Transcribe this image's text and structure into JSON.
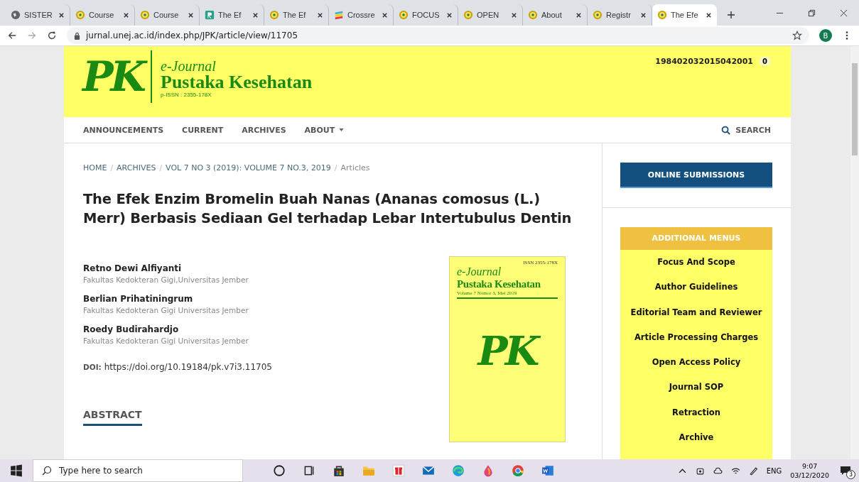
{
  "browser": {
    "tabs": [
      {
        "title": "SISTER",
        "kind": "globe",
        "selected": false
      },
      {
        "title": "Course",
        "kind": "seal",
        "selected": false
      },
      {
        "title": "Course",
        "kind": "seal",
        "selected": false
      },
      {
        "title": "The Ef",
        "kind": "r",
        "selected": false
      },
      {
        "title": "The Ef",
        "kind": "seal",
        "selected": false
      },
      {
        "title": "Crossre",
        "kind": "stripes",
        "selected": false
      },
      {
        "title": "FOCUS",
        "kind": "seal",
        "selected": false
      },
      {
        "title": "OPEN",
        "kind": "seal",
        "selected": false
      },
      {
        "title": "About",
        "kind": "seal",
        "selected": false
      },
      {
        "title": "Registr",
        "kind": "seal",
        "selected": false
      },
      {
        "title": "The Efe",
        "kind": "seal",
        "selected": true
      }
    ],
    "url": "jurnal.unej.ac.id/index.php/JPK/article/view/11705",
    "profile": "B"
  },
  "header": {
    "logo": "PK",
    "ejournal": "e-Journal",
    "name": "Pustaka Kesehatan",
    "issn": "p-ISSN : 2355-178X",
    "user": "198402032015042001",
    "count": "0"
  },
  "nav": {
    "items": [
      "ANNOUNCEMENTS",
      "CURRENT",
      "ARCHIVES",
      "ABOUT"
    ],
    "search": "SEARCH"
  },
  "breadcrumb": {
    "separator": "/",
    "items": [
      "HOME",
      "ARCHIVES",
      "VOL 7 NO 3 (2019): VOLUME 7 NO.3, 2019",
      "Articles"
    ]
  },
  "article": {
    "title": "The Efek Enzim Bromelin Buah Nanas (Ananas comosus (L.) Merr) Berbasis Sediaan Gel terhadap Lebar Intertubulus Dentin",
    "authors": [
      {
        "name": "Retno Dewi Alfiyanti",
        "affiliation": "Fakultas Kedokteran Gigi,Universitas Jember"
      },
      {
        "name": "Berlian Prihatiningrum",
        "affiliation": "Fakultas Kedokteran Gigi Universitas Jember"
      },
      {
        "name": "Roedy Budirahardjo",
        "affiliation": "Fakultas Kedokteran Gigi Universitas Jember"
      }
    ],
    "doi_label": "DOI:",
    "doi": "https://doi.org/10.19184/pk.v7i3.11705",
    "abstract_heading": "ABSTRACT",
    "cover": {
      "issn": "ISSN 2355-178X",
      "ejournal": "e-Journal",
      "name": "Pustaka Kesehatan",
      "issue": "Volume 7 Nomor 3, Mei 2019",
      "logo": "PK"
    }
  },
  "sidebar": {
    "submit": "ONLINE SUBMISSIONS",
    "menu_title": "ADDITIONAL MENUS",
    "menu": [
      "Focus And Scope",
      "Author Guidelines",
      "Editorial Team and Reviewer",
      "Article Processing Charges",
      "Open Access Policy",
      "Journal SOP",
      "Retraction",
      "Archive"
    ]
  },
  "taskbar": {
    "search": "Type here to search",
    "lang": "ENG",
    "time": "9:07",
    "date": "03/12/2020",
    "notifications": "3"
  }
}
